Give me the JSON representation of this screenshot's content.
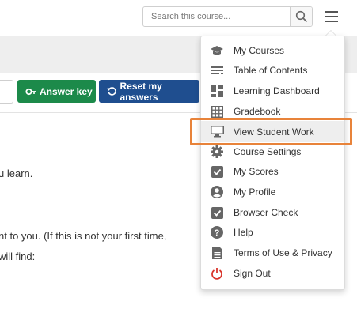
{
  "header": {
    "search_placeholder": "Search this course..."
  },
  "toolbar": {
    "answer_key_label": "Answer key",
    "reset_label": "Reset my answers",
    "answer_color": "#1c8a4a",
    "reset_color": "#1f4e8f"
  },
  "content": {
    "lines": [
      "u learn.",
      "nt to you. (If this is not your first time,",
      "will find:"
    ]
  },
  "menu": {
    "highlight_color": "#e8833a",
    "items": [
      {
        "label": "My Courses",
        "icon": "graduation-cap-icon"
      },
      {
        "label": "Table of Contents",
        "icon": "list-icon"
      },
      {
        "label": "Learning Dashboard",
        "icon": "dashboard-icon"
      },
      {
        "label": "Gradebook",
        "icon": "table-grid-icon"
      },
      {
        "label": "View Student Work",
        "icon": "monitor-icon"
      },
      {
        "label": "Course Settings",
        "icon": "gear-icon"
      },
      {
        "label": "My Scores",
        "icon": "checkbox-icon"
      },
      {
        "label": "My Profile",
        "icon": "user-icon"
      },
      {
        "label": "Browser Check",
        "icon": "checkbox-icon"
      },
      {
        "label": "Help",
        "icon": "help-icon"
      },
      {
        "label": "Terms of Use & Privacy",
        "icon": "document-icon"
      },
      {
        "label": "Sign Out",
        "icon": "power-icon"
      }
    ]
  }
}
